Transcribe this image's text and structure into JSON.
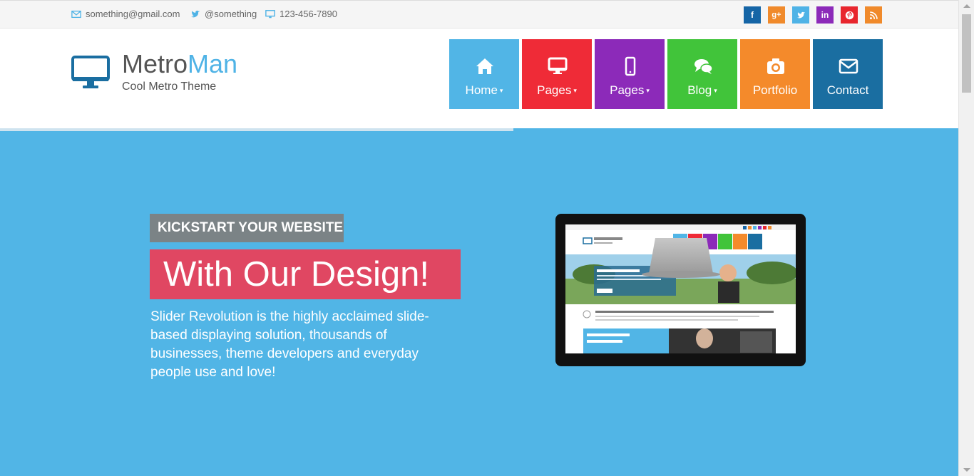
{
  "topbar": {
    "email": "something@gmail.com",
    "twitter": "@something",
    "phone": "123-456-7890",
    "social": [
      {
        "name": "facebook",
        "glyph": "f",
        "color": "#1565a6"
      },
      {
        "name": "google-plus",
        "glyph": "g+",
        "color": "#f08a2b"
      },
      {
        "name": "twitter",
        "glyph": "t",
        "color": "#4fb3e6"
      },
      {
        "name": "linkedin",
        "glyph": "in",
        "color": "#8c2ab9"
      },
      {
        "name": "pinterest",
        "glyph": "P",
        "color": "#e8262d"
      },
      {
        "name": "rss",
        "glyph": "rss",
        "color": "#f08a2b"
      }
    ]
  },
  "header": {
    "logo_part1": "Metro",
    "logo_part2": "Man",
    "tagline": "Cool Metro Theme",
    "nav": [
      {
        "label": "Home",
        "caret": "▾",
        "icon": "home-icon",
        "color": "#51b5e6"
      },
      {
        "label": "Pages",
        "caret": "▾",
        "icon": "desktop-icon",
        "color": "#ef2b37"
      },
      {
        "label": "Pages",
        "caret": "▾",
        "icon": "mobile-icon",
        "color": "#8c2ab9"
      },
      {
        "label": "Blog",
        "caret": "▾",
        "icon": "comments-icon",
        "color": "#41c43a"
      },
      {
        "label": "Portfolio",
        "caret": "",
        "icon": "camera-icon",
        "color": "#f48a2b"
      },
      {
        "label": "Contact",
        "caret": "",
        "icon": "envelope-icon",
        "color": "#1a6ea1"
      }
    ]
  },
  "hero": {
    "kicker": "KICKSTART YOUR WEBSITE",
    "headline": "With Our Design!",
    "description": "Slider Revolution is the highly acclaimed slide-based displaying solution, thousands of businesses, theme developers and everyday people use and love!"
  },
  "colors": {
    "accent": "#51b5e6",
    "kicker_bg": "#7b8386",
    "headline_bg": "#e04762"
  }
}
